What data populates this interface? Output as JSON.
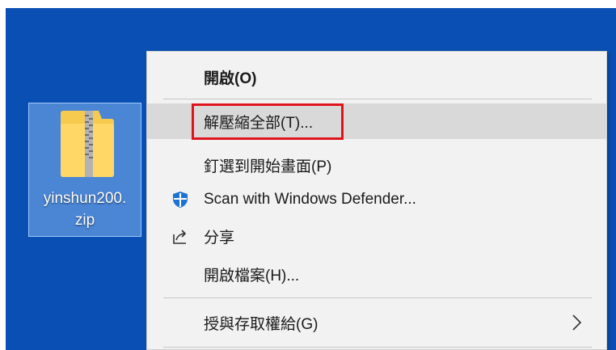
{
  "desktop": {
    "file": {
      "name_line1": "yinshun200.",
      "name_line2": "zip",
      "icon": "zip-folder-icon"
    }
  },
  "context_menu": {
    "items": [
      {
        "label": "開啟(O)",
        "bold": true
      },
      {
        "label": "解壓縮全部(T)...",
        "highlighted": true
      },
      {
        "label": "釘選到開始畫面(P)"
      },
      {
        "label": "Scan with Windows Defender...",
        "icon": "windows-defender-shield-icon"
      },
      {
        "label": "分享",
        "icon": "share-icon"
      },
      {
        "label": "開啟檔案(H)..."
      },
      {
        "label": "授與存取權給(G)",
        "submenu": true,
        "icon": "chevron-right-icon"
      }
    ]
  },
  "colors": {
    "desktop_bg": "#0a4fb3",
    "menu_bg": "#f2f2f2",
    "hover_bg": "#d9d9d9",
    "highlight_border": "#e0141c",
    "defender_blue": "#1e73d0"
  }
}
